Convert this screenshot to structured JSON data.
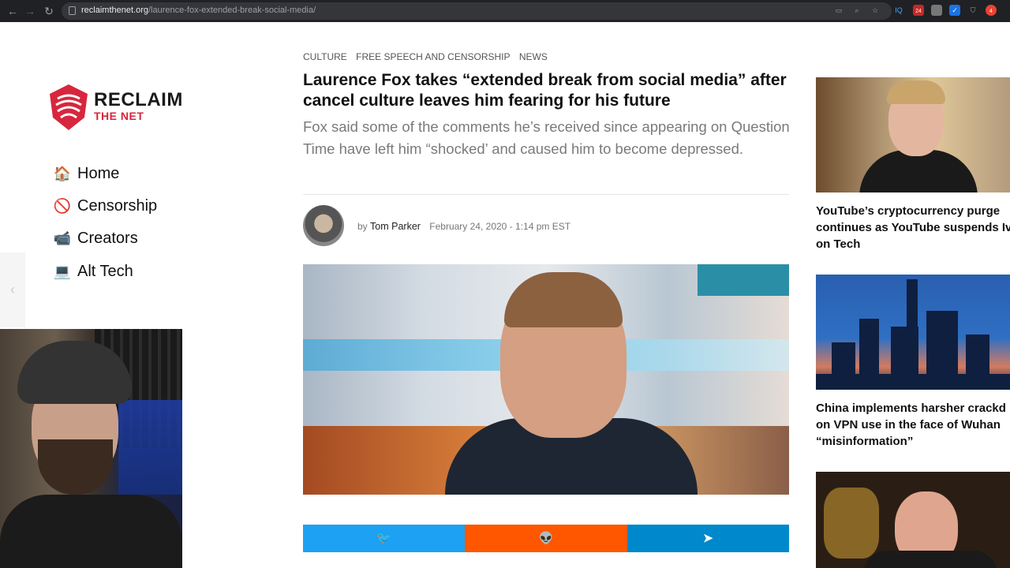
{
  "browser": {
    "url_domain": "reclaimthenet.org",
    "url_path": "/laurence-fox-extended-break-social-media/",
    "ext_badge_1": "24",
    "ext_badge_2": "4"
  },
  "site": {
    "logo_main": "RECLAIM",
    "logo_sub": "THE NET",
    "nav": [
      {
        "label": "Home",
        "icon": "house-icon",
        "glyph": "🏠"
      },
      {
        "label": "Censorship",
        "icon": "prohibited-icon",
        "glyph": "🚫"
      },
      {
        "label": "Creators",
        "icon": "video-camera-icon",
        "glyph": "📹"
      },
      {
        "label": "Alt Tech",
        "icon": "laptop-icon",
        "glyph": "💻"
      }
    ]
  },
  "article": {
    "categories": [
      "Culture",
      "Free Speech and Censorship",
      "News"
    ],
    "headline": "Laurence Fox takes “extended break from social media” after cancel culture leaves him fearing for his future",
    "subhead": "Fox said some of the comments he’s received since appearing on Question Time have left him “shocked’ and caused him to become depressed.",
    "by": "by",
    "author": "Tom Parker",
    "date": "February 24, 2020 - 1:14 pm EST"
  },
  "share": {
    "twitter_icon": "🐦",
    "reddit_icon": "👽",
    "telegram_icon": "➤"
  },
  "sidebar": {
    "cards": [
      {
        "title": "YouTube’s cryptocurrency purge\ncontinues as YouTube suspends Iv\non Tech"
      },
      {
        "title": "China implements harsher crackd\non VPN use in the face of Wuhan\n“misinformation”"
      },
      {
        "title": ""
      }
    ]
  },
  "colors": {
    "twitter": "#1da1f2",
    "reddit": "#ff5700",
    "telegram": "#0088cc",
    "brand_red": "#d7263d"
  }
}
